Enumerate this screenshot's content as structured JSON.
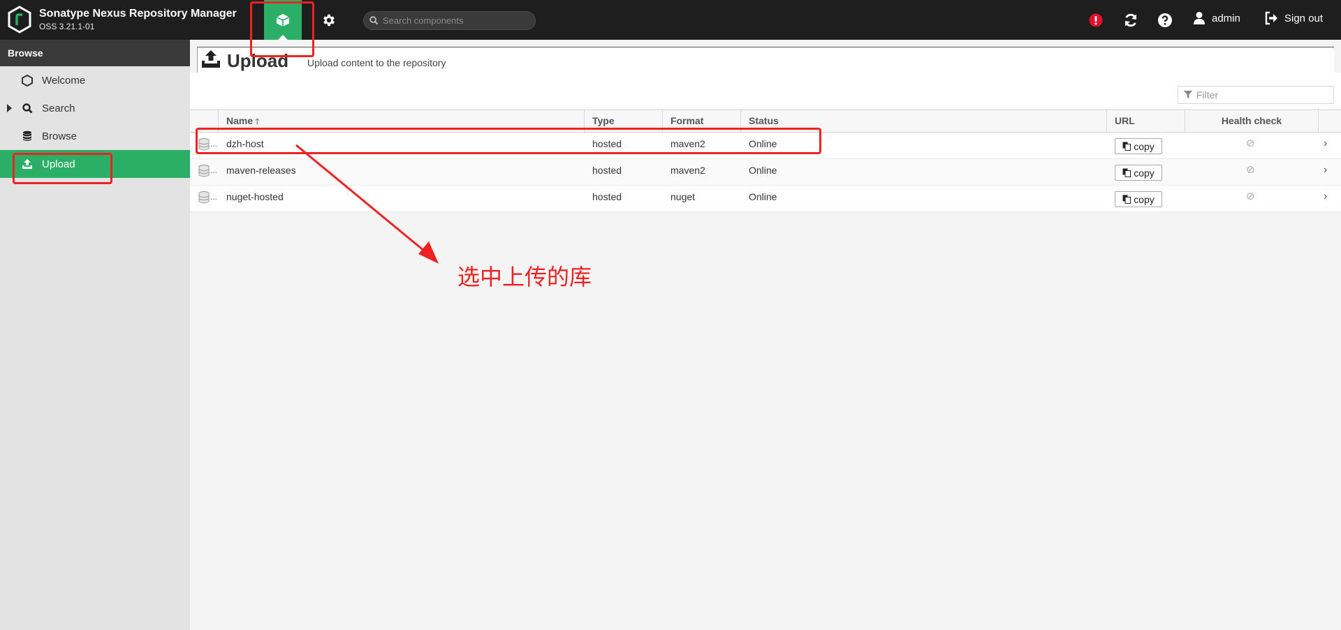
{
  "header": {
    "app_title": "Sonatype Nexus Repository Manager",
    "version": "OSS 3.21.1-01",
    "search_placeholder": "Search components",
    "user_label": "admin",
    "signout_label": "Sign out",
    "icons": [
      "browse-cube-icon",
      "admin-gear-icon",
      "search-icon",
      "alert-icon",
      "refresh-icon",
      "help-icon",
      "user-icon",
      "sign-out-icon"
    ]
  },
  "sidebar": {
    "title": "Browse",
    "items": [
      {
        "label": "Welcome",
        "icon": "hexagon-icon"
      },
      {
        "label": "Search",
        "icon": "search-icon"
      },
      {
        "label": "Browse",
        "icon": "database-icon"
      },
      {
        "label": "Upload",
        "icon": "upload-icon",
        "active": true
      }
    ]
  },
  "page": {
    "title": "Upload",
    "subtitle": "Upload content to the repository",
    "filter_placeholder": "Filter"
  },
  "table": {
    "columns": [
      "Name",
      "Type",
      "Format",
      "Status",
      "URL",
      "Health check"
    ],
    "sort_column": "Name",
    "rows": [
      {
        "name": "dzh-host",
        "type": "hosted",
        "format": "maven2",
        "status": "Online",
        "url_action": "copy"
      },
      {
        "name": "maven-releases",
        "type": "hosted",
        "format": "maven2",
        "status": "Online",
        "url_action": "copy"
      },
      {
        "name": "nuget-hosted",
        "type": "hosted",
        "format": "nuget",
        "status": "Online",
        "url_action": "copy"
      }
    ]
  },
  "annotation": {
    "text": "选中上传的库",
    "color": "#ee2222"
  },
  "colors": {
    "header_bg": "#1e1e1e",
    "accent_green": "#2bae66",
    "alert_red": "#e0102f"
  }
}
